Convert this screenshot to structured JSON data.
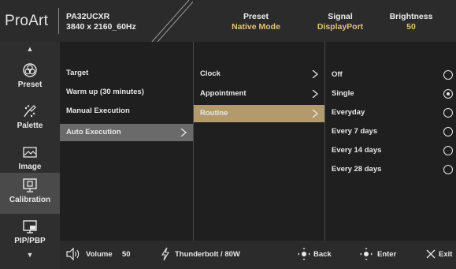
{
  "header": {
    "brand": "ProArt",
    "model_line1": "PA32UCXR",
    "model_line2": "3840 x 2160_60Hz",
    "preset_label": "Preset",
    "preset_value": "Native Mode",
    "signal_label": "Signal",
    "signal_value": "DisplayPort",
    "brightness_label": "Brightness",
    "brightness_value": "50"
  },
  "sidebar": {
    "items": [
      {
        "label": "Preset",
        "icon": "preset-icon"
      },
      {
        "label": "Palette",
        "icon": "palette-icon"
      },
      {
        "label": "Image",
        "icon": "image-icon"
      },
      {
        "label": "Calibration",
        "icon": "calibration-icon",
        "active": true
      },
      {
        "label": "PIP/PBP",
        "icon": "pip-pbp-icon"
      }
    ]
  },
  "columns": {
    "level1": [
      "Target",
      "Warm up (30 minutes)",
      "Manual Execution",
      "Auto Execution"
    ],
    "level2": [
      "Clock",
      "Appointment",
      "Routine"
    ],
    "level3": [
      "Off",
      "Single",
      "Everyday",
      "Every 7 days",
      "Every 14 days",
      "Every 28 days"
    ]
  },
  "footer": {
    "volume_label": "Volume",
    "volume_value": "50",
    "input_label": "Thunderbolt / 80W",
    "back_label": "Back",
    "enter_label": "Enter",
    "exit_label": "Exit"
  },
  "colors": {
    "accent_gold": "#e3c17a",
    "selected_row": "#b39a6d",
    "highlight_row": "#6a6a6a"
  }
}
